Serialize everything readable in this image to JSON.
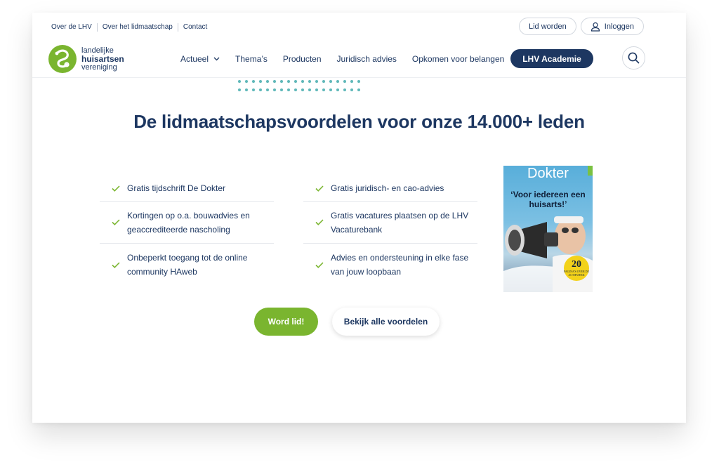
{
  "utility_nav": {
    "links": [
      "Over de LHV",
      "Over het lidmaatschap",
      "Contact"
    ],
    "join_label": "Lid worden",
    "login_label": "Inloggen"
  },
  "logo": {
    "line1": "landelijke",
    "line2": "huisartsen",
    "line3": "vereniging"
  },
  "main_nav": {
    "items": [
      "Actueel",
      "Thema’s",
      "Producten",
      "Juridisch advies",
      "Opkomen voor belangen"
    ],
    "academy_label": "LHV Academie"
  },
  "hero": {
    "heading": "De lidmaatschapsvoordelen voor onze 14.000+ leden"
  },
  "benefits": {
    "left": [
      "Gratis tijdschrift De Dokter",
      "Kortingen op o.a. bouwadvies en geaccrediteerde nascholing",
      "Onbeperkt toegang tot de online community HAweb"
    ],
    "right": [
      "Gratis juridisch- en cao-advies",
      "Gratis vacatures plaatsen op de LHV Vacaturebank",
      "Advies en ondersteuning in elke fase van jouw loopbaan"
    ]
  },
  "magazine": {
    "title": "Dokter",
    "quote": "‘Voor iedereen een huisarts!’",
    "badge_number": "20",
    "badge_text": "PAGINA'S OVER DE ACTIEWEEK"
  },
  "cta": {
    "primary_label": "Word lid!",
    "secondary_label": "Bekijk alle voordelen"
  },
  "colors": {
    "navy": "#1d3761",
    "green": "#7ab52f",
    "teal_dots": "#5fb8b9"
  }
}
